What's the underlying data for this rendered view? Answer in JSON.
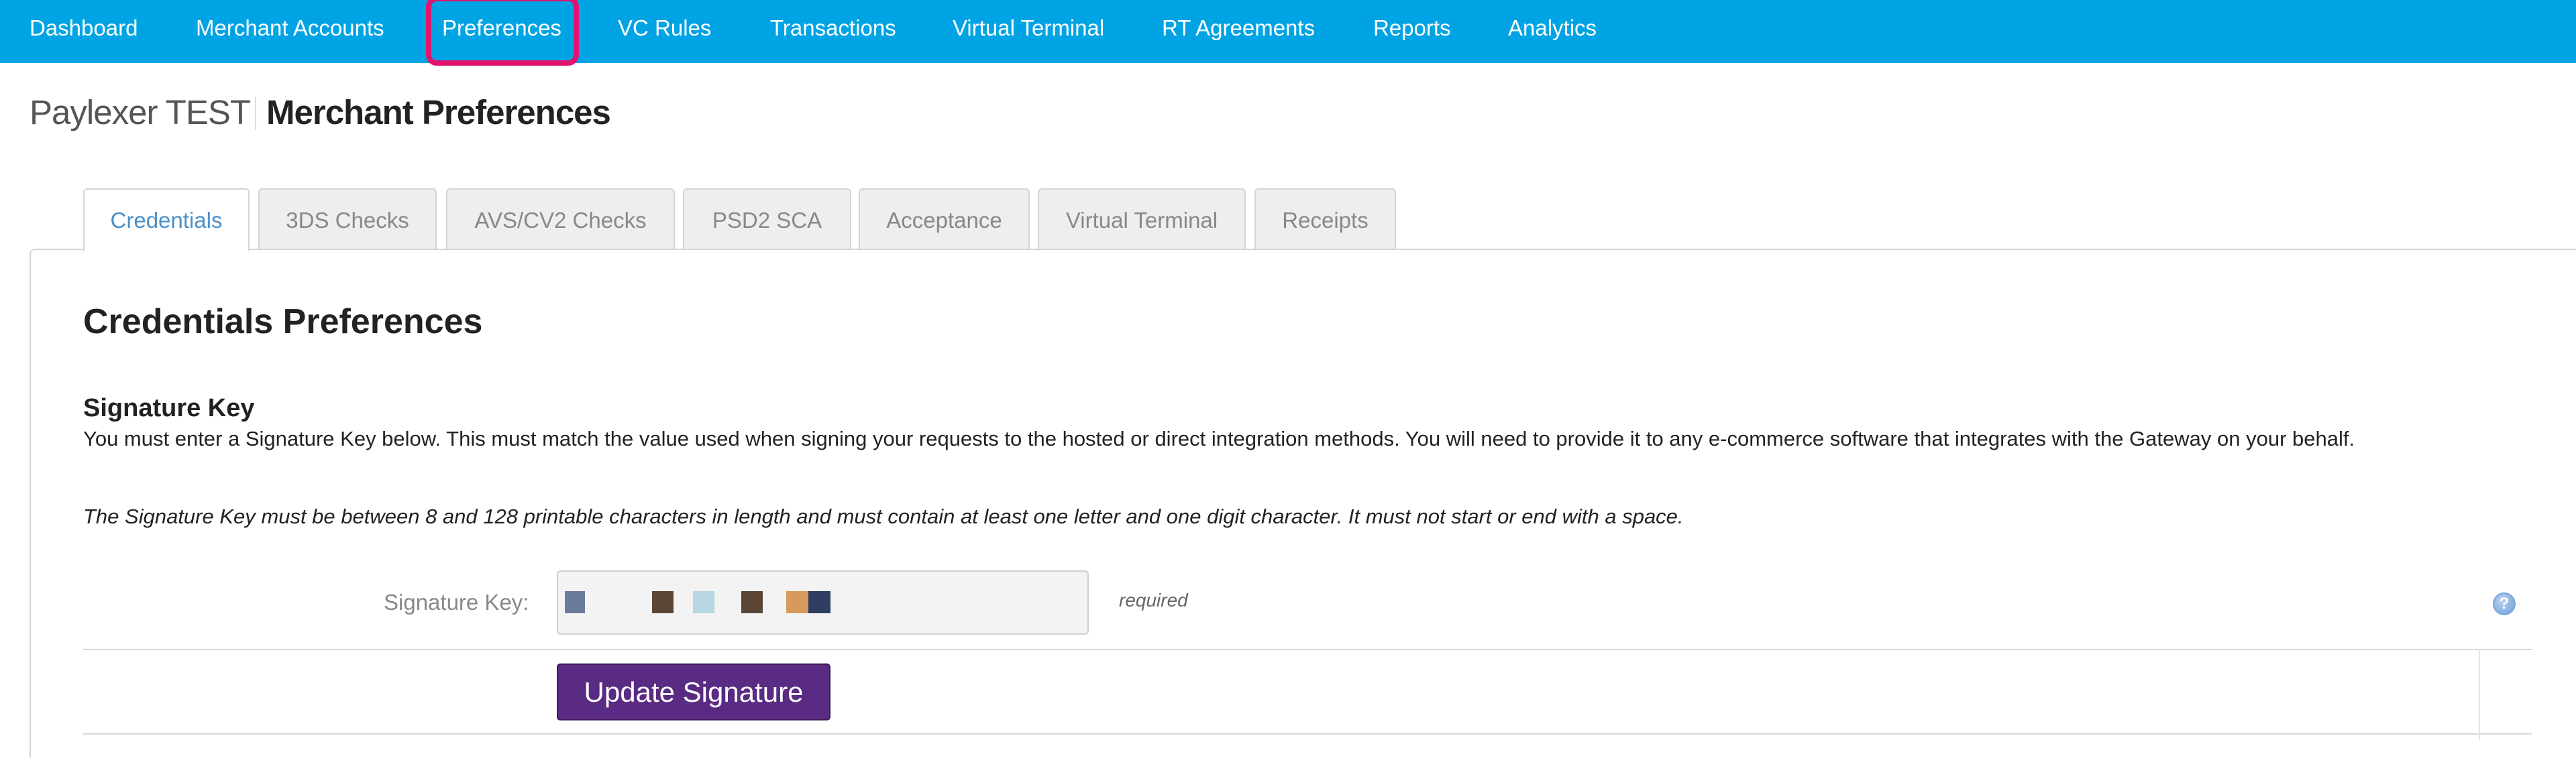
{
  "nav": {
    "items": [
      {
        "label": "Dashboard"
      },
      {
        "label": "Merchant Accounts"
      },
      {
        "label": "Preferences"
      },
      {
        "label": "VC Rules"
      },
      {
        "label": "Transactions"
      },
      {
        "label": "Virtual Terminal"
      },
      {
        "label": "RT Agreements"
      },
      {
        "label": "Reports"
      },
      {
        "label": "Analytics"
      }
    ],
    "highlighted": "Preferences",
    "background_color": "#00a4e4",
    "highlight_color": "#e0146e"
  },
  "header": {
    "brand": "Paylexer TEST",
    "title": "Merchant Preferences"
  },
  "tabs": [
    {
      "label": "Credentials",
      "active": true
    },
    {
      "label": "3DS Checks"
    },
    {
      "label": "AVS/CV2 Checks"
    },
    {
      "label": "PSD2 SCA"
    },
    {
      "label": "Acceptance"
    },
    {
      "label": "Virtual Terminal"
    },
    {
      "label": "Receipts"
    }
  ],
  "section": {
    "title": "Credentials Preferences",
    "subtitle": "Signature Key",
    "description": "You must enter a Signature Key below. This must match the value used when signing your requests to the hosted or direct integration methods. You will need to provide it to any e-commerce software that integrates with the Gateway on your behalf.",
    "note": "The Signature Key must be between 8 and 128 printable characters in length and must contain at least one letter and one digit character. It must not start or end with a space."
  },
  "form": {
    "signature_label": "Signature Key:",
    "signature_value_redacted": true,
    "redaction_colors": [
      "#6b7b9c",
      "#5b4636",
      "#b9d6e4",
      "#5b4636",
      "#d69b5a",
      "#2e3e63"
    ],
    "required_text": "required",
    "help_icon": "question-circle-icon",
    "update_button": "Update Signature",
    "update_button_color": "#5a2b82"
  }
}
